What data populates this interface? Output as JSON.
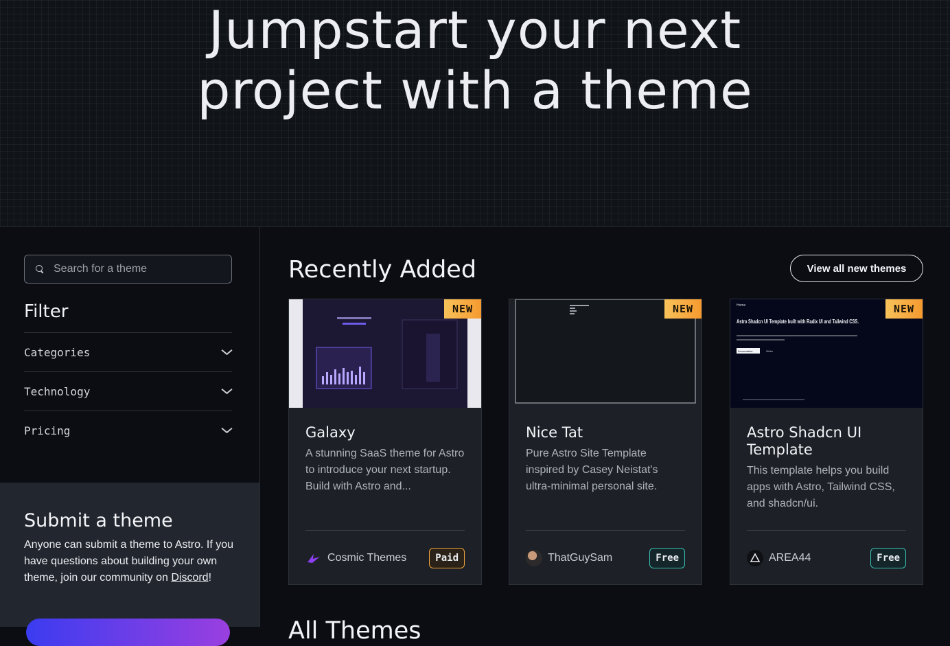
{
  "hero": {
    "line1": "Jumpstart your next",
    "line2": "project with a theme"
  },
  "sidebar": {
    "search_placeholder": "Search for a theme",
    "filter_title": "Filter",
    "filters": [
      {
        "label": "Categories"
      },
      {
        "label": "Technology"
      },
      {
        "label": "Pricing"
      }
    ],
    "submit": {
      "title": "Submit a theme",
      "text": "Anyone can submit a theme to Astro. If you have questions about building your own theme, join our community on ",
      "link": "Discord",
      "after_link": "!"
    }
  },
  "main": {
    "section_title": "Recently Added",
    "view_all_label": "View all new themes",
    "next_section_title": "All Themes",
    "cards": [
      {
        "badge": "NEW",
        "title": "Galaxy",
        "description": "A stunning SaaS theme for Astro to introduce your next startup. Build with Astro and...",
        "author": "Cosmic Themes",
        "price": "Paid"
      },
      {
        "badge": "NEW",
        "title": "Nice Tat",
        "description": "Pure Astro Site Template inspired by Casey Neistat's ultra-minimal personal site.",
        "author": "ThatGuySam",
        "price": "Free"
      },
      {
        "badge": "NEW",
        "title": "Astro Shadcn UI Template",
        "description": "This template helps you build apps with Astro, Tailwind CSS, and shadcn/ui.",
        "author": "AREA44",
        "price": "Free",
        "thumb": {
          "nav": "Home",
          "headline": "Astro Shadcn UI Template built with Radix UI and Tailwind CSS.",
          "btn1": "Documentation",
          "btn2": "GitHub"
        }
      }
    ]
  },
  "colors": {
    "background": "#0b0d12",
    "card": "#1d2127",
    "badge_new": "#f8c25a",
    "paid_border": "#f2a33a",
    "free_border": "#39c0b5",
    "cta_gradient_start": "#3b3cf0",
    "cta_gradient_end": "#9a3fe0"
  },
  "icons": [
    "search-icon",
    "chevron-down-icon",
    "cosmic-themes-logo-icon",
    "thatguysam-avatar-icon",
    "area44-triangle-icon"
  ]
}
